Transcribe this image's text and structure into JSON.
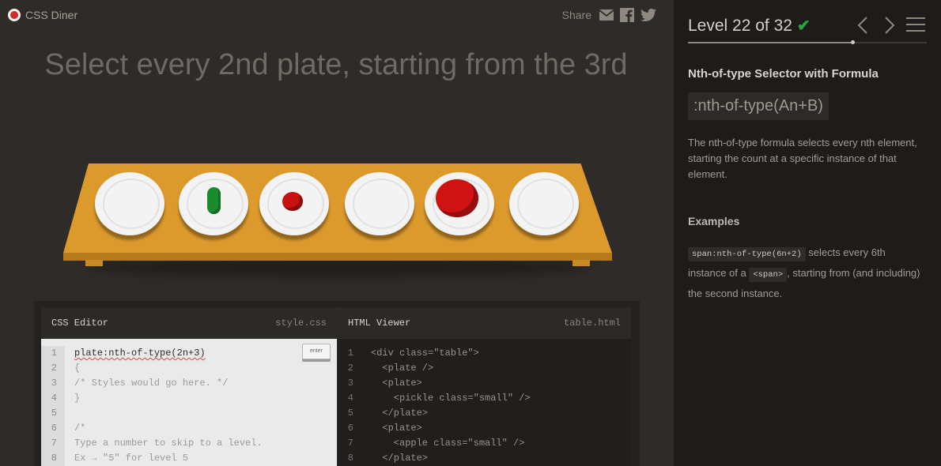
{
  "header": {
    "app_name": "CSS Diner",
    "share_label": "Share",
    "share_icons": [
      "email-icon",
      "facebook-icon",
      "twitter-icon"
    ]
  },
  "instruction": "Select every 2nd plate, starting from the 3rd",
  "table": {
    "items": [
      "plate",
      "plate with small pickle",
      "plate with small apple",
      "plate",
      "plate with apple",
      "plate"
    ]
  },
  "editor": {
    "css": {
      "title": "CSS Editor",
      "file": "style.css",
      "enter_label": "enter",
      "lines": [
        {
          "n": "1",
          "text": "plate:nth-of-type(2n+3)"
        },
        {
          "n": "2",
          "text": "{"
        },
        {
          "n": "3",
          "text": "/* Styles would go here. */"
        },
        {
          "n": "4",
          "text": "}"
        },
        {
          "n": "5",
          "text": ""
        },
        {
          "n": "6",
          "text": "/*"
        },
        {
          "n": "7",
          "text": "Type a number to skip to a level."
        },
        {
          "n": "8",
          "text": "Ex → \"5\" for level 5"
        }
      ]
    },
    "html": {
      "title": "HTML Viewer",
      "file": "table.html",
      "lines": [
        {
          "n": "1",
          "text": "<div class=\"table\">"
        },
        {
          "n": "2",
          "text": "  <plate />"
        },
        {
          "n": "3",
          "text": "  <plate>"
        },
        {
          "n": "4",
          "text": "    <pickle class=\"small\" />"
        },
        {
          "n": "5",
          "text": "  </plate>"
        },
        {
          "n": "6",
          "text": "  <plate>"
        },
        {
          "n": "7",
          "text": "    <apple class=\"small\" />"
        },
        {
          "n": "8",
          "text": "  </plate>"
        }
      ]
    }
  },
  "sidebar": {
    "level_title": "Level 22 of 32",
    "check_mark": "✔",
    "progress": 0.6875,
    "selector_name": "Nth-of-type Selector with Formula",
    "syntax": ":nth-of-type(An+B)",
    "description": "The nth-of-type formula selects every nth element, starting the count at a specific instance of that element.",
    "examples_title": "Examples",
    "example": {
      "code1": "span:nth-of-type(6n+2)",
      "text1": " selects every 6th instance of a ",
      "code2": "<span>",
      "text2": ", starting from (and including) the second instance."
    }
  },
  "colors": {
    "background": "#2e2b28",
    "sidebar": "#1e1c1a",
    "table": "#dc9a2c",
    "accent_check": "#2aa345",
    "apple": "#cf1212",
    "pickle": "#1b8c2e"
  }
}
